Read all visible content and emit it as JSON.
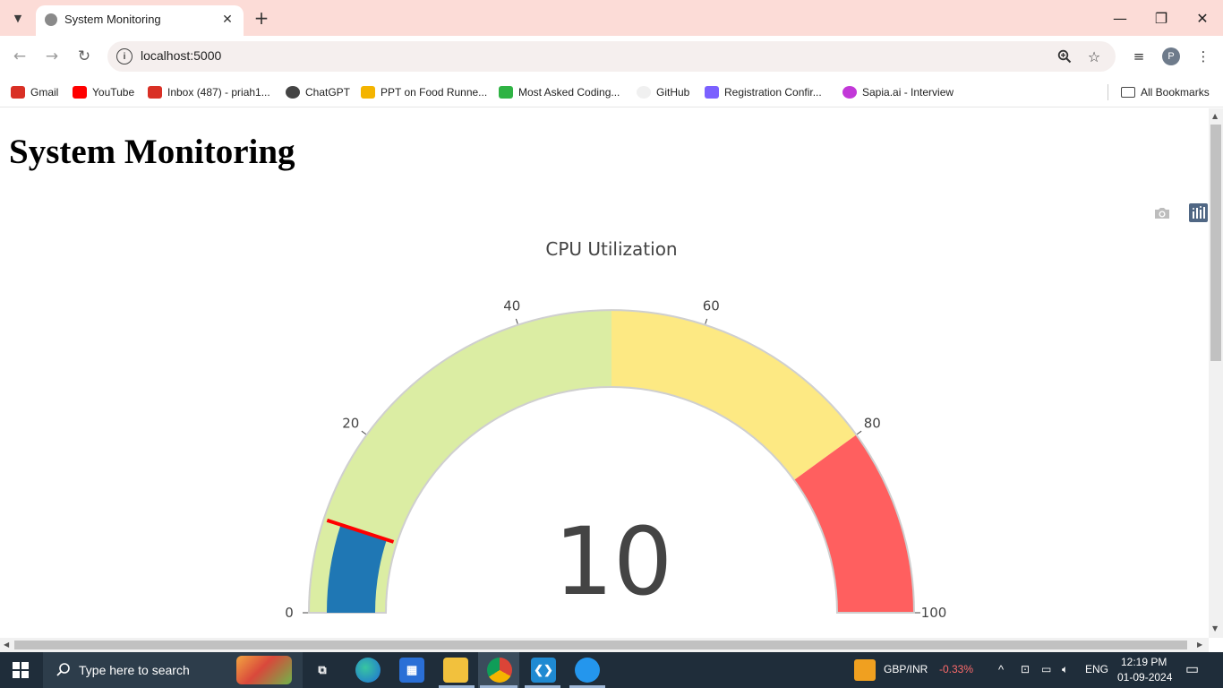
{
  "browser": {
    "tab_title": "System Monitoring",
    "url": "localhost:5000",
    "bookmarks": [
      {
        "label": "Gmail",
        "icon": "gmail-icon",
        "color": "#d93025"
      },
      {
        "label": "YouTube",
        "icon": "youtube-icon",
        "color": "#ff0000"
      },
      {
        "label": "Inbox (487) - priah1...",
        "icon": "gmail-icon",
        "color": "#d93025"
      },
      {
        "label": "ChatGPT",
        "icon": "chatgpt-icon",
        "color": "#444444"
      },
      {
        "label": "PPT on Food Runne...",
        "icon": "slides-icon",
        "color": "#f4b400"
      },
      {
        "label": "Most Asked Coding...",
        "icon": "shield-icon",
        "color": "#2fb344"
      },
      {
        "label": "GitHub",
        "icon": "github-icon",
        "color": "#eeeeee"
      },
      {
        "label": "Registration Confir...",
        "icon": "cube-icon",
        "color": "#7b61ff"
      },
      {
        "label": "Sapia.ai - Interview",
        "icon": "sapia-icon",
        "color": "#c238d8"
      }
    ],
    "all_bookmarks": "All Bookmarks",
    "profile_initial": "P"
  },
  "page": {
    "title": "System Monitoring"
  },
  "chart_data": {
    "type": "gauge",
    "title": "CPU Utilization",
    "value": 10,
    "value_label": "10",
    "range": [
      0,
      100
    ],
    "ticks": [
      "0",
      "20",
      "40",
      "60",
      "80",
      "100"
    ],
    "steps": [
      {
        "range": [
          0,
          50
        ],
        "color": "#dbeda3"
      },
      {
        "range": [
          50,
          80
        ],
        "color": "#fde983"
      },
      {
        "range": [
          80,
          100
        ],
        "color": "#ff5f5f"
      }
    ],
    "bar_color": "#1f77b4",
    "threshold": {
      "value": 10,
      "color": "#ff0000"
    }
  },
  "taskbar": {
    "search_placeholder": "Type here to search",
    "ticker_label": "GBP/INR",
    "ticker_change": "-0.33%",
    "language": "ENG",
    "time": "12:19 PM",
    "date": "01-09-2024"
  }
}
